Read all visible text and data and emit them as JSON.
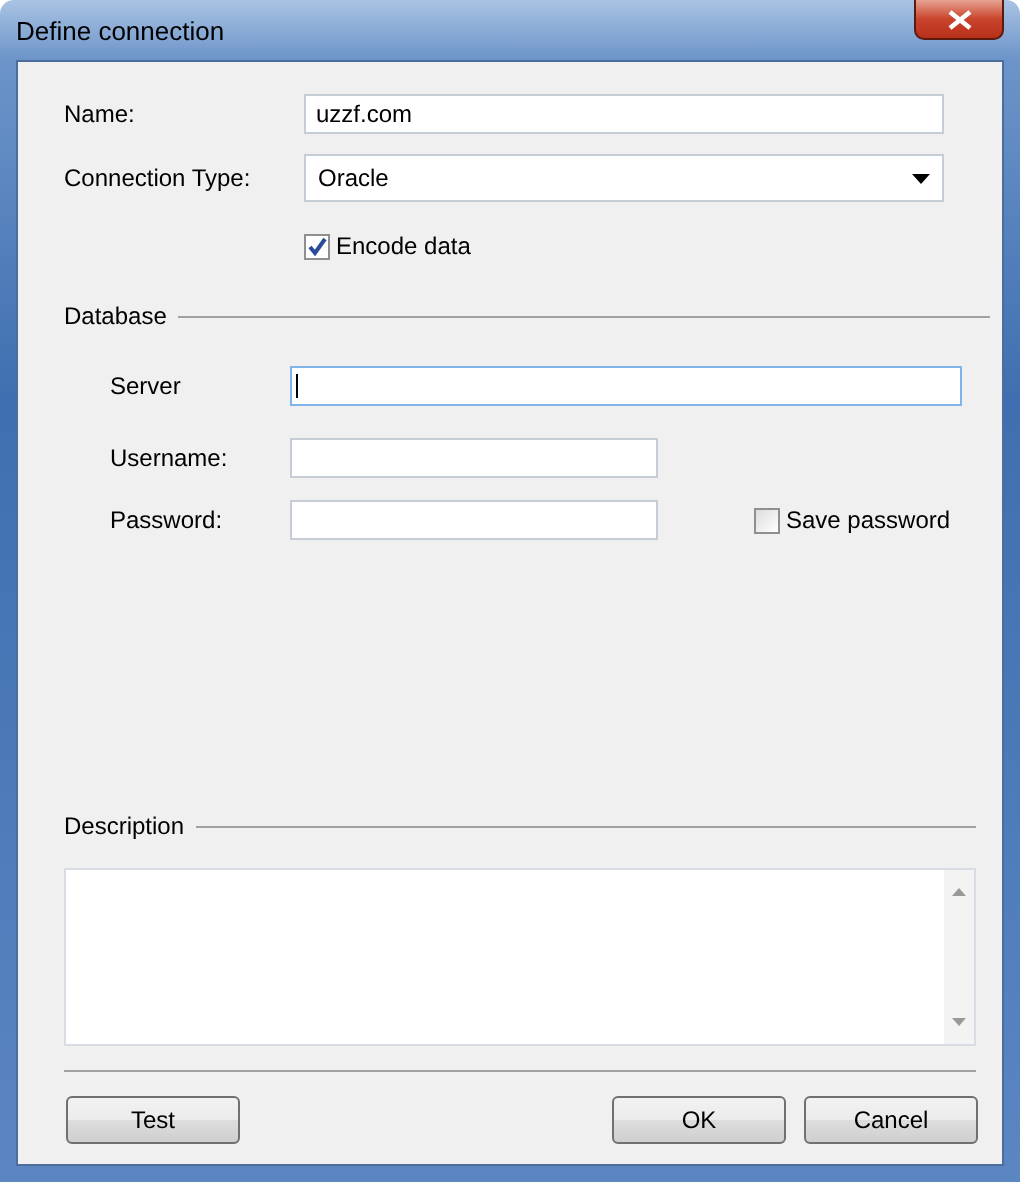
{
  "window": {
    "title": "Define connection"
  },
  "fields": [
    {
      "label": "Name:",
      "value": "uzzf.com",
      "kind": "text"
    },
    {
      "label": "Connection Type:",
      "value": "Oracle",
      "kind": "dropdown"
    }
  ],
  "encode_data": {
    "label": "Encode data",
    "checked": true
  },
  "database": {
    "title": "Database",
    "server": {
      "label": "Server",
      "focused": true
    },
    "username": {
      "label": "Username:"
    },
    "password": {
      "label": "Password:"
    },
    "save_password": {
      "label": "Save password",
      "checked": false
    }
  },
  "description": {
    "title": "Description"
  },
  "buttons": [
    {
      "label": "Test"
    },
    {
      "label": "OK"
    },
    {
      "label": "Cancel"
    }
  ]
}
